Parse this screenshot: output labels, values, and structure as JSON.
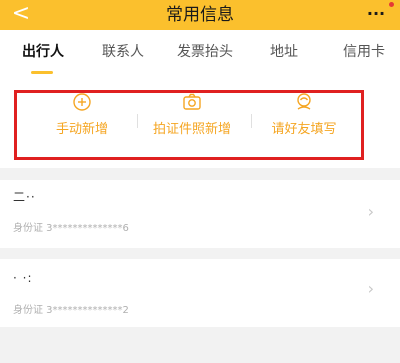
{
  "navbar": {
    "back_glyph": "<",
    "title": "常用信息",
    "more_glyph": "···"
  },
  "tabs": [
    {
      "label": "出行人",
      "active": true
    },
    {
      "label": "联系人",
      "active": false
    },
    {
      "label": "发票抬头",
      "active": false
    },
    {
      "label": "地址",
      "active": false
    },
    {
      "label": "信用卡",
      "active": false
    }
  ],
  "actions": [
    {
      "label": "手动新增",
      "icon": "plus-circle-icon"
    },
    {
      "label": "拍证件照新增",
      "icon": "camera-icon"
    },
    {
      "label": "请好友填写",
      "icon": "friend-icon"
    }
  ],
  "travelers": [
    {
      "name": "二··",
      "id_text": "身份证 3**************6"
    },
    {
      "name": "· ·:",
      "id_text": "身份证 3**************2"
    }
  ],
  "colors": {
    "navbar_bg": "#fbc02d",
    "accent": "#f5a623",
    "highlight_border": "#e02020",
    "page_bg": "#f2f2f2"
  }
}
